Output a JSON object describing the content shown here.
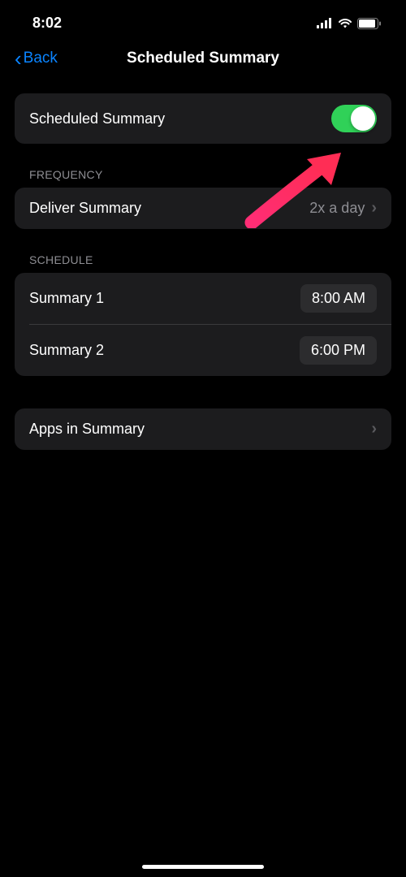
{
  "status": {
    "time": "8:02"
  },
  "nav": {
    "back": "Back",
    "title": "Scheduled Summary"
  },
  "main_toggle": {
    "label": "Scheduled Summary",
    "enabled": true
  },
  "frequency": {
    "header": "FREQUENCY",
    "label": "Deliver Summary",
    "value": "2x a day"
  },
  "schedule": {
    "header": "SCHEDULE",
    "items": [
      {
        "label": "Summary 1",
        "time": "8:00 AM"
      },
      {
        "label": "Summary 2",
        "time": "6:00 PM"
      }
    ]
  },
  "apps": {
    "label": "Apps in Summary"
  },
  "colors": {
    "accent": "#0a84ff",
    "toggle_on": "#30d158",
    "arrow": "#ff2d55"
  }
}
